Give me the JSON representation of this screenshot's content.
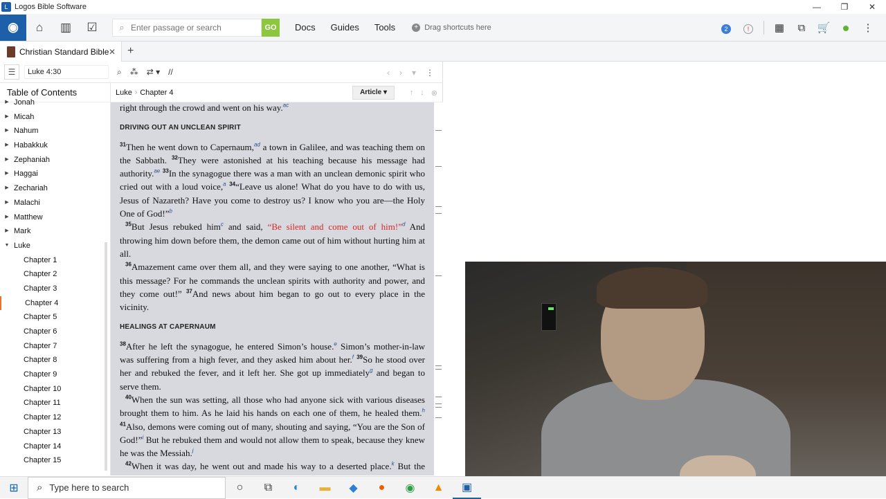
{
  "window": {
    "title": "Logos Bible Software",
    "minimize": "—",
    "maximize": "❐",
    "close": "✕"
  },
  "toolbar": {
    "search_placeholder": "Enter passage or search",
    "go_label": "GO",
    "menus": [
      "Docs",
      "Guides",
      "Tools"
    ],
    "drag_hint": "Drag shortcuts here",
    "notification_count": "2",
    "alert_symbol": "!"
  },
  "tab": {
    "title": "Christian Standard Bible",
    "close": "✕",
    "add": "+"
  },
  "panel": {
    "reference": "Luke 4:30",
    "link_symbol": "//"
  },
  "toc": {
    "title": "Table of Contents",
    "items": [
      {
        "label": "Jonah",
        "child": false
      },
      {
        "label": "Micah",
        "child": false
      },
      {
        "label": "Nahum",
        "child": false
      },
      {
        "label": "Habakkuk",
        "child": false
      },
      {
        "label": "Zephaniah",
        "child": false
      },
      {
        "label": "Haggai",
        "child": false
      },
      {
        "label": "Zechariah",
        "child": false
      },
      {
        "label": "Malachi",
        "child": false
      },
      {
        "label": "Matthew",
        "child": false
      },
      {
        "label": "Mark",
        "child": false
      },
      {
        "label": "Luke",
        "child": false,
        "expanded": true
      },
      {
        "label": "Chapter 1",
        "child": true
      },
      {
        "label": "Chapter 2",
        "child": true
      },
      {
        "label": "Chapter 3",
        "child": true
      },
      {
        "label": "Chapter 4",
        "child": true,
        "active": true
      },
      {
        "label": "Chapter 5",
        "child": true
      },
      {
        "label": "Chapter 6",
        "child": true
      },
      {
        "label": "Chapter 7",
        "child": true
      },
      {
        "label": "Chapter 8",
        "child": true
      },
      {
        "label": "Chapter 9",
        "child": true
      },
      {
        "label": "Chapter 10",
        "child": true
      },
      {
        "label": "Chapter 11",
        "child": true
      },
      {
        "label": "Chapter 12",
        "child": true
      },
      {
        "label": "Chapter 13",
        "child": true
      },
      {
        "label": "Chapter 14",
        "child": true
      },
      {
        "label": "Chapter 15",
        "child": true
      }
    ]
  },
  "reader": {
    "breadcrumb_book": "Luke",
    "breadcrumb_chapter": "Chapter 4",
    "view_mode": "Article",
    "top_line": "right through the crowd and went on his way.",
    "top_line_fn": "ac",
    "heading1": "DRIVING OUT AN UNCLEAN SPIRIT",
    "heading2": "HEALINGS AT CAPERNAUM",
    "v31_num": "31",
    "v31": "Then he went down to Capernaum,",
    "v31_fn": "ad",
    "v31b": " a town in Galilee, and was teaching them on the Sabbath.",
    "v32_num": "32",
    "v32": "They were astonished at his teaching because his message had authority.",
    "v32_fn": "ae",
    "v33_num": "33",
    "v33": "In the synagogue there was a man with an unclean demonic spirit who cried out with a loud voice,",
    "v33_fn": "a",
    "v34_num": "34",
    "v34": "“Leave us alone! What do you have to do with us, Jesus of Nazareth? Have you come to destroy us? I know who you are—the Holy One of God!”",
    "v34_fn": "b",
    "v35_num": "35",
    "v35a": "But Jesus rebuked him",
    "v35_fn1": "c",
    "v35b": " and said, ",
    "v35_red": "“Be silent and come out of him!”",
    "v35_fn2": "d",
    "v35c": " And throwing him down before them, the demon came out of him without hurting him at all.",
    "v36_num": "36",
    "v36": "Amazement came over them all, and they were saying to one another, “What is this message? For he commands the unclean spirits with authority and power, and they come out!”",
    "v37_num": "37",
    "v37": "And news about him began to go out to every place in the vicinity.",
    "v38_num": "38",
    "v38": "After he left the synagogue, he entered Simon’s house.",
    "v38_fn": "e",
    "v38b": " Simon’s mother-in-law was suffering from a high fever, and they asked him about her.",
    "v38_fn2": "f",
    "v39_num": "39",
    "v39": "So he stood over her and rebuked the fever, and it left her. She got up immediately",
    "v39_fn": "g",
    "v39b": " and began to serve them.",
    "v40_num": "40",
    "v40": "When the sun was setting, all those who had anyone sick with various diseases brought them to him. As he laid his hands on each one of them, he healed them.",
    "v40_fn": "h",
    "v41_num": "41",
    "v41": "Also, demons were coming out of many, shouting and saying, “You are the Son of God!”",
    "v41_fn": "i",
    "v41b": " But he rebuked them and would not allow them to speak, because they knew he was the Messiah.",
    "v41_fn2": "j",
    "v42_num": "42",
    "v42": "When it was day, he went out and made his way to a deserted place.",
    "v42_fn": "k",
    "v42b": " But the crowds were searching for him. They came to him and tried to keep him"
  },
  "taskbar": {
    "search_placeholder": "Type here to search"
  },
  "colors": {
    "accent": "#1d5fa8",
    "go": "#8dc63f",
    "words_of_christ": "#d42a2a",
    "reader_bg": "#d8d9de"
  }
}
